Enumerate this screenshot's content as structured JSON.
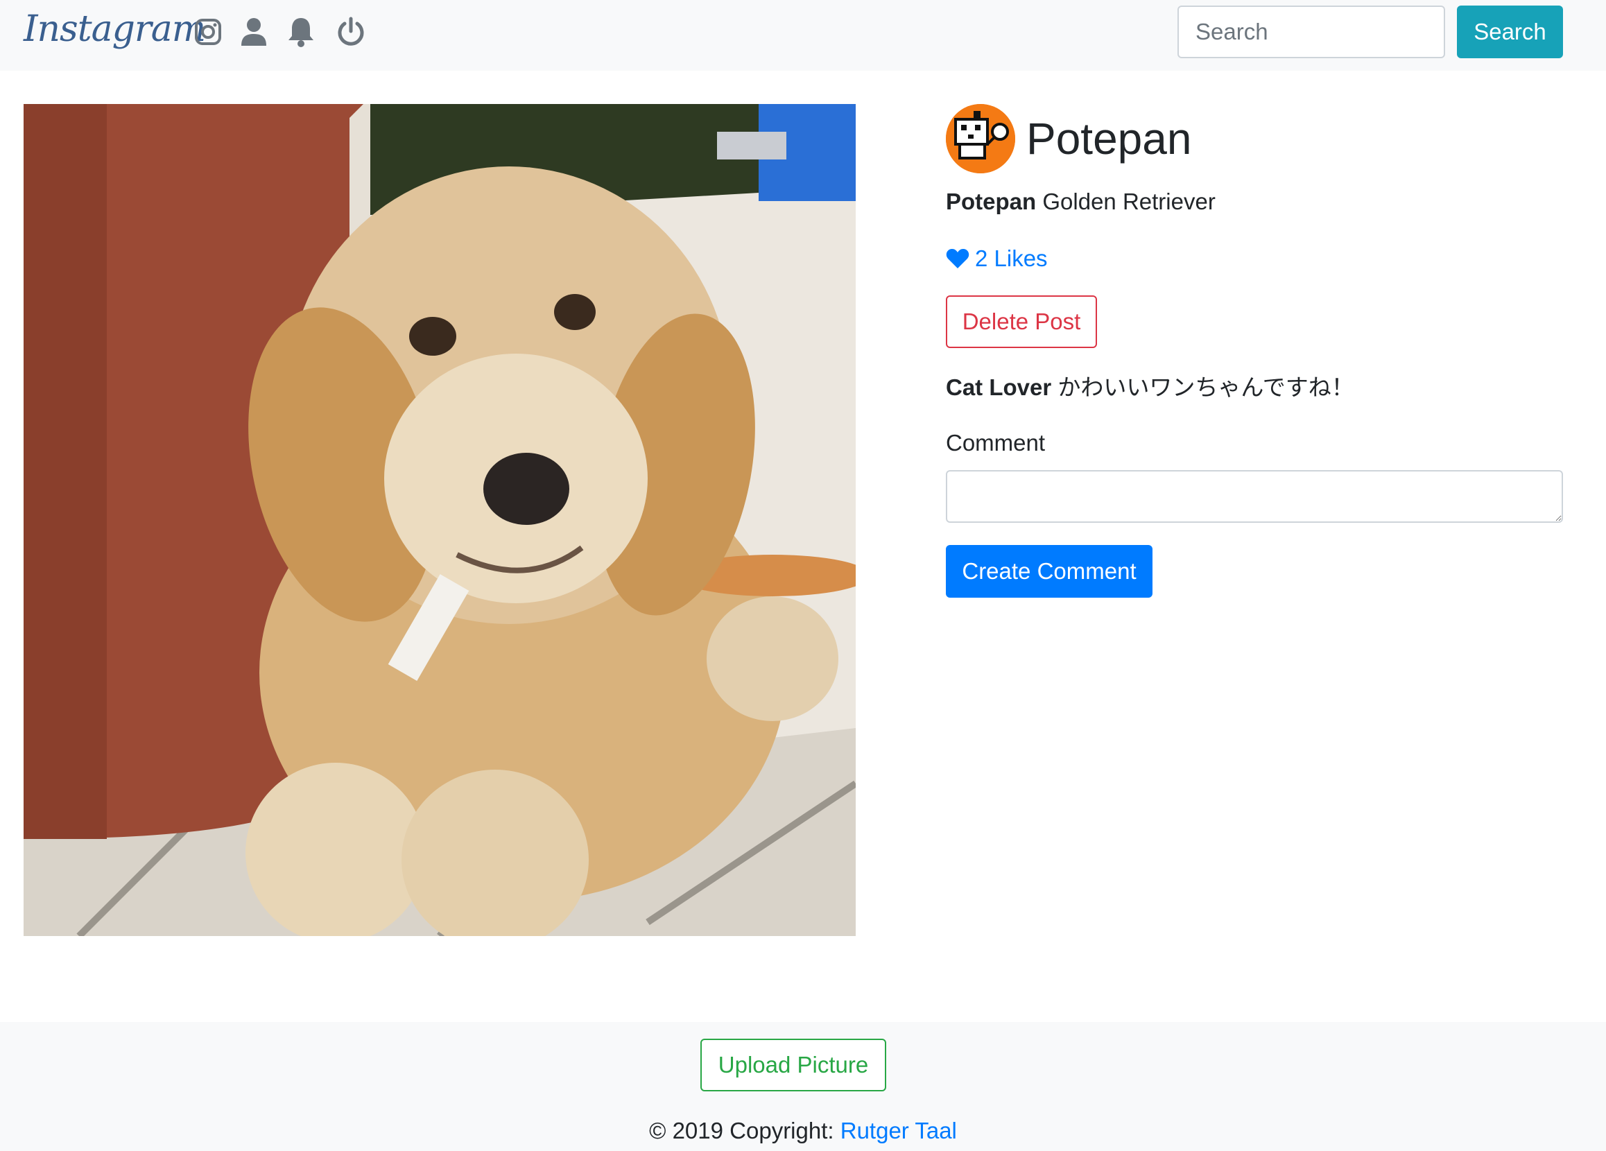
{
  "navbar": {
    "brand": "Instagram",
    "icons": [
      "instagram-icon",
      "user-icon",
      "bell-icon",
      "power-icon"
    ],
    "search": {
      "placeholder": "Search",
      "button_label": "Search"
    }
  },
  "post": {
    "image_subject": "golden-retriever-puppy",
    "username": "Potepan",
    "caption_user": "Potepan",
    "caption_text": "Golden Retriever",
    "likes_label": "2 Likes",
    "delete_label": "Delete Post",
    "comments": [
      {
        "user": "Cat Lover",
        "text": "かわいいワンちゃんですね！"
      }
    ],
    "comment_label": "Comment",
    "comment_value": "",
    "create_comment_label": "Create Comment"
  },
  "footer": {
    "upload_label": "Upload Picture",
    "copyright_prefix": "© 2019 Copyright:",
    "copyright_link": "Rutger Taal"
  },
  "colors": {
    "navbar_bg": "#f8f9fa",
    "info": "#17a2b8",
    "primary": "#007bff",
    "danger": "#dc3545",
    "success": "#28a745",
    "avatar_bg": "#f47a14"
  }
}
